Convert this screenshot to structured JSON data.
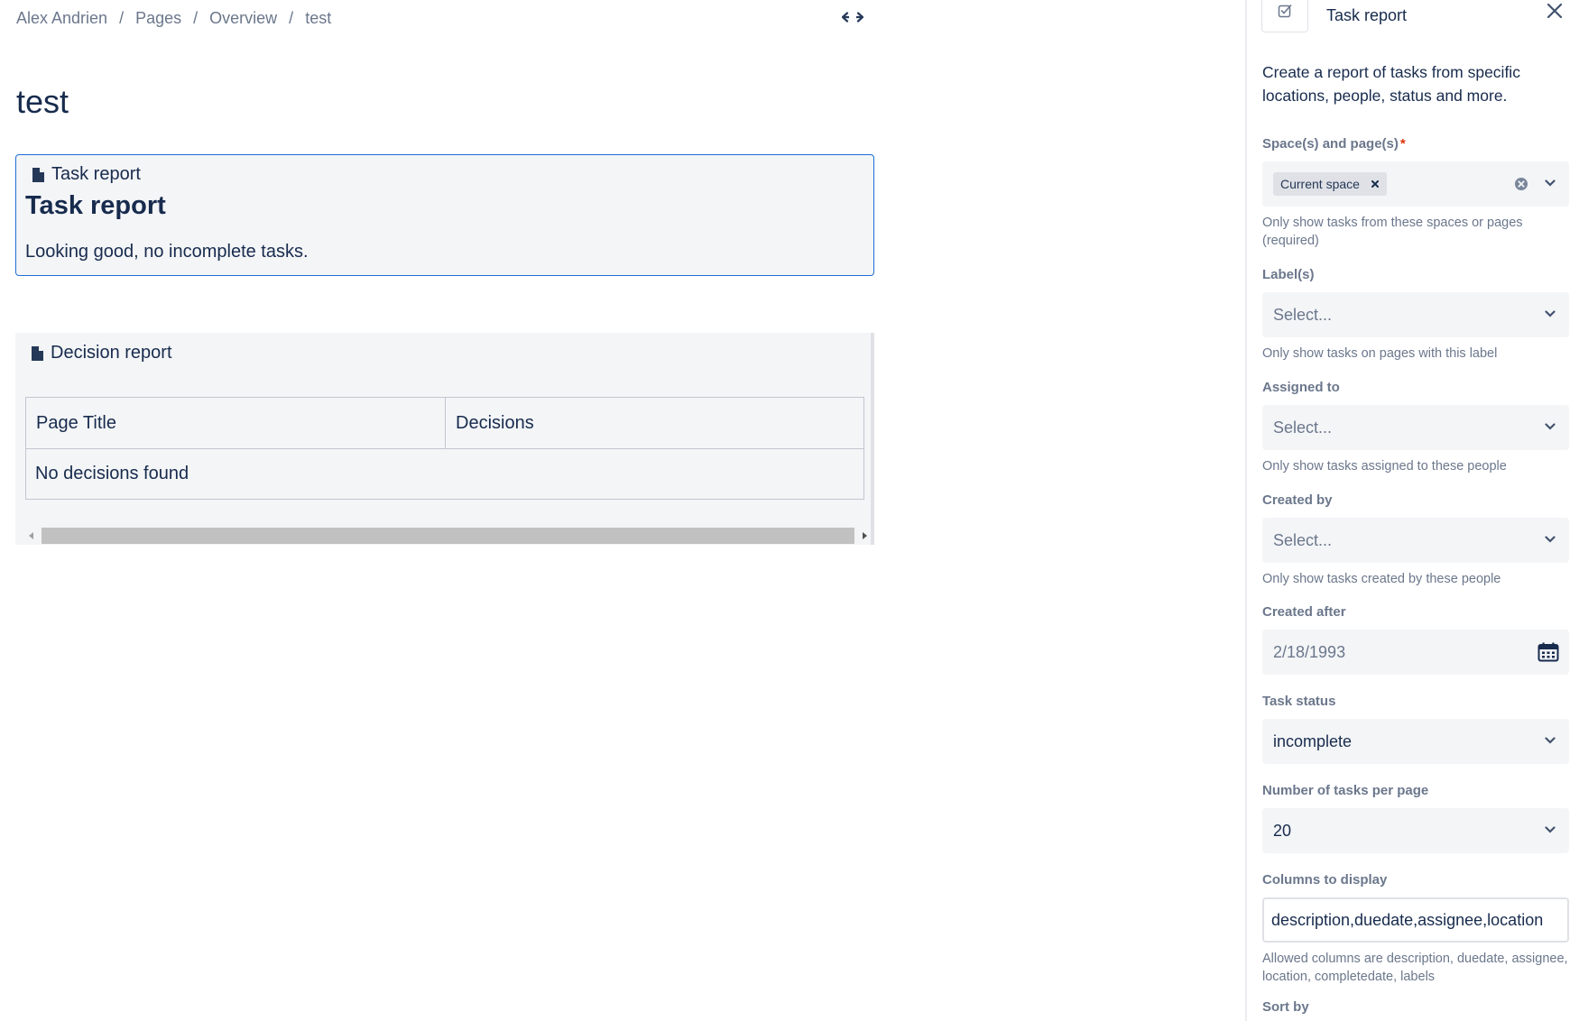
{
  "breadcrumb": {
    "items": [
      "Alex Andrien",
      "Pages",
      "Overview",
      "test"
    ],
    "separator": "/"
  },
  "page": {
    "title": "test"
  },
  "task_macro": {
    "label": "Task report",
    "heading": "Task report",
    "message": "Looking good, no incomplete tasks."
  },
  "decision_macro": {
    "label": "Decision report",
    "columns": [
      "Page Title",
      "Decisions"
    ],
    "empty_message": "No decisions found"
  },
  "panel": {
    "title": "Task report",
    "description": "Create a report of tasks from specific locations, people, status and more.",
    "fields": {
      "spaces": {
        "label": "Space(s) and page(s)",
        "required_mark": "*",
        "tag": "Current space",
        "helper": "Only show tasks from these spaces or pages (required)"
      },
      "labels": {
        "label": "Label(s)",
        "placeholder": "Select...",
        "helper": "Only show tasks on pages with this label"
      },
      "assigned": {
        "label": "Assigned to",
        "placeholder": "Select...",
        "helper": "Only show tasks assigned to these people"
      },
      "created_by": {
        "label": "Created by",
        "placeholder": "Select...",
        "helper": "Only show tasks created by these people"
      },
      "created_after": {
        "label": "Created after",
        "value": "2/18/1993"
      },
      "status": {
        "label": "Task status",
        "value": "incomplete"
      },
      "per_page": {
        "label": "Number of tasks per page",
        "value": "20"
      },
      "columns": {
        "label": "Columns to display",
        "value": "description,duedate,assignee,location",
        "helper": "Allowed columns are description, duedate, assignee, location, completedate, labels"
      },
      "sort_by": {
        "label": "Sort by"
      }
    }
  },
  "colors": {
    "text": "#172b4d",
    "muted": "#6b778c",
    "macro_border": "#1d6fd6",
    "field_bg": "#f4f5f7",
    "required": "#de350b"
  },
  "icons": {
    "width_toggle": "expand-width-icon",
    "macro": "document-icon",
    "panel": "task-checkbox-icon",
    "close": "close-icon",
    "chevron": "chevron-down-icon",
    "clear": "clear-icon",
    "calendar": "calendar-icon"
  }
}
